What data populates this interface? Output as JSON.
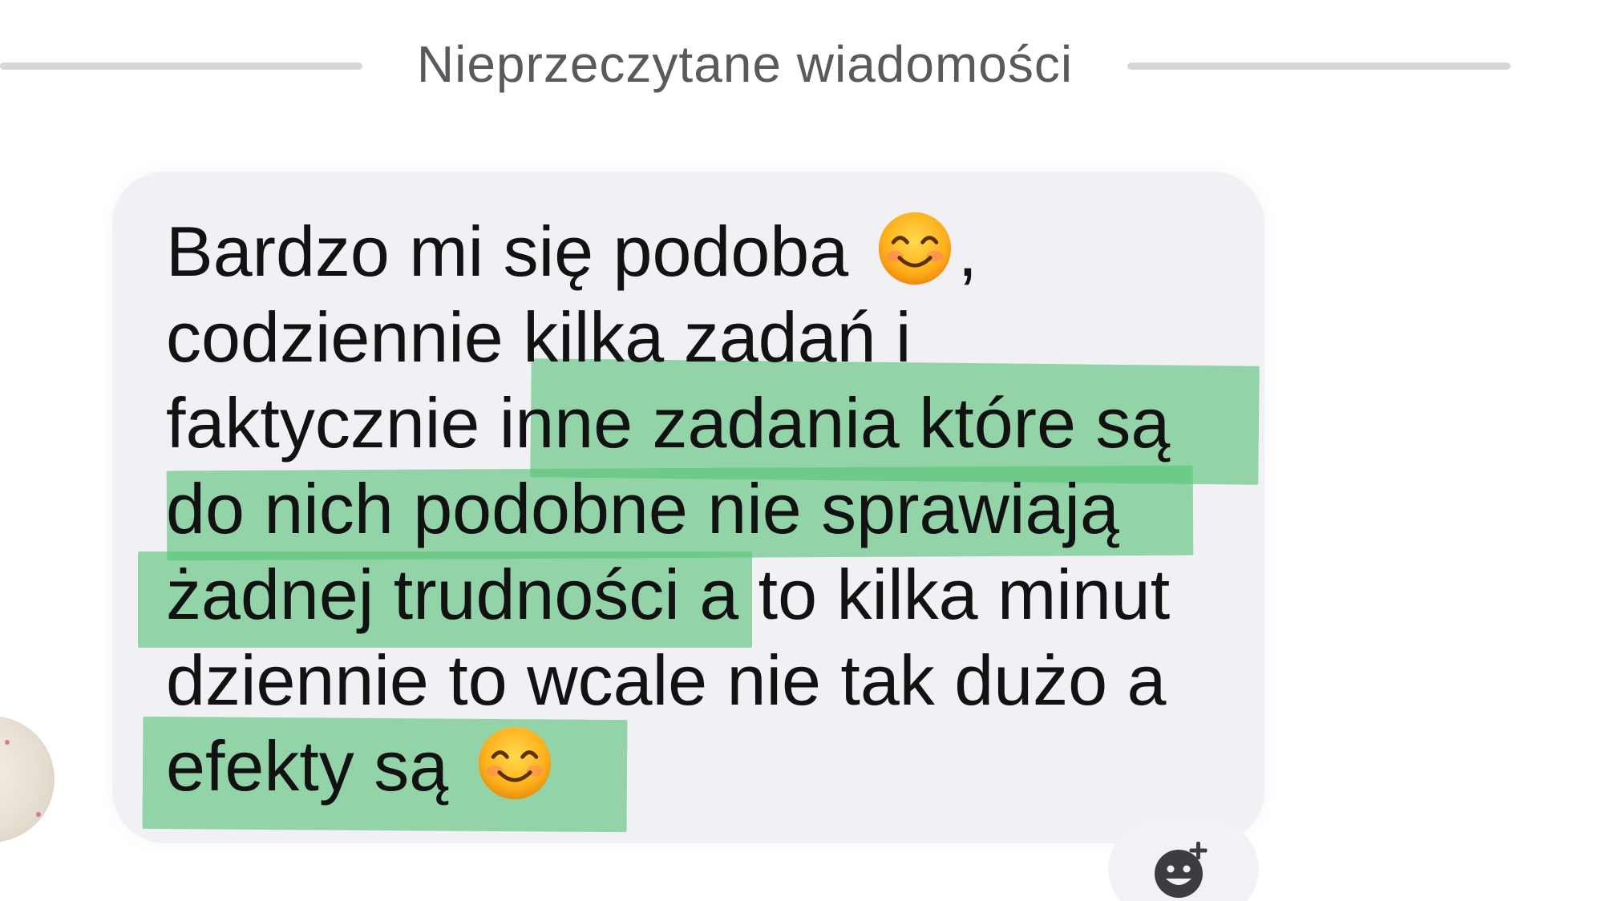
{
  "divider": {
    "label": "Nieprzeczytane wiadomości"
  },
  "message": {
    "lines": [
      {
        "before": "Bardzo mi się podoba ",
        "emoji": "smiling-face-icon",
        "after": ","
      },
      {
        "text": "codziennie kilka zadań i"
      },
      {
        "text": "faktycznie inne zadania które są"
      },
      {
        "text": "do nich podobne nie sprawiają"
      },
      {
        "text": "żadnej trudności a to kilka minut"
      },
      {
        "text": "dziennie to wcale nie tak dużo a"
      },
      {
        "before": "efekty są ",
        "emoji": "smiling-face-icon",
        "after": ""
      }
    ],
    "highlight_color": "#58c478",
    "bubble_color": "#f0f0f5",
    "text_color": "#121212"
  },
  "reaction_button": {
    "icon": "add-reaction-icon"
  }
}
